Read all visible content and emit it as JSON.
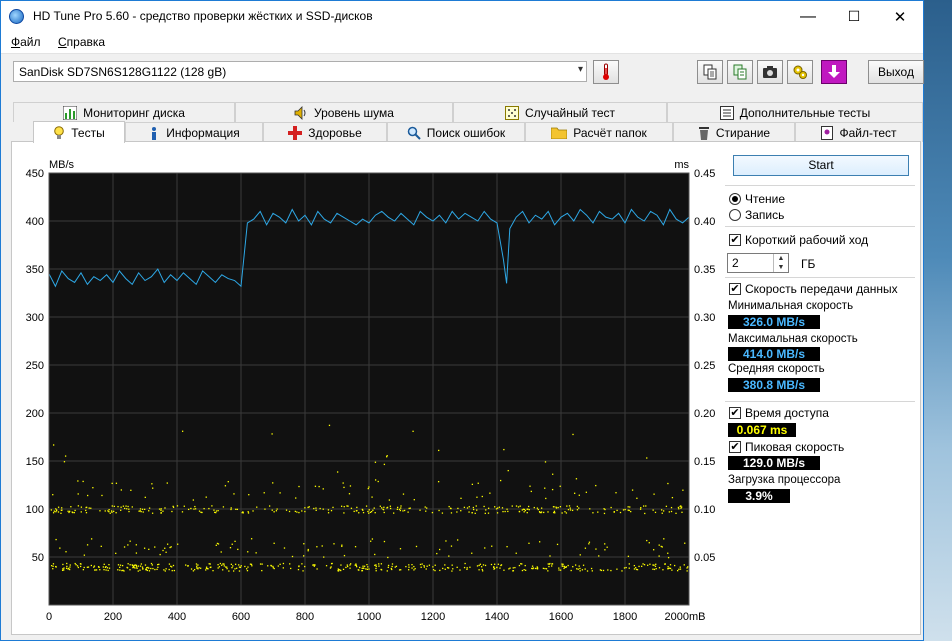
{
  "window": {
    "title": "HD Tune Pro 5.60 - средство проверки жёстких и SSD-дисков",
    "minimize_glyph": "—",
    "maximize_glyph": "☐",
    "close_glyph": "✕"
  },
  "menu": [
    "Файл",
    "Справка"
  ],
  "toolbar": {
    "drive": "SanDisk SD7SN6S128G1122 (128 gB)",
    "exit_label": "Выход",
    "icons": [
      "thermometer-icon",
      "copy-icon",
      "copy-all-icon",
      "camera-icon",
      "settings-icon",
      "download-icon"
    ]
  },
  "tabs_top": [
    {
      "label": "Мониторинг диска",
      "icon": "▮"
    },
    {
      "label": "Уровень шума",
      "icon": "🔊"
    },
    {
      "label": "Случайный тест",
      "icon": "▦"
    },
    {
      "label": "Дополнительные тесты",
      "icon": "▤"
    }
  ],
  "tabs_bottom": [
    {
      "label": "Тесты",
      "icon": "💡"
    },
    {
      "label": "Информация",
      "icon": "ℹ"
    },
    {
      "label": "Здоровье",
      "icon": "✚"
    },
    {
      "label": "Поиск ошибок",
      "icon": "🔍"
    },
    {
      "label": "Расчёт папок",
      "icon": "📁"
    },
    {
      "label": "Стирание",
      "icon": "🗑"
    },
    {
      "label": "Файл-тест",
      "icon": "📄"
    }
  ],
  "panel": {
    "start_label": "Start",
    "read_label": "Чтение",
    "write_label": "Запись",
    "short_stroke_label": "Короткий рабочий ход",
    "short_stroke_value": "2",
    "short_stroke_unit": "ГБ",
    "transfer_rate_label": "Скорость передачи данных",
    "min_label": "Минимальная скорость",
    "min_value": "326.0 MB/s",
    "max_label": "Максимальная скорость",
    "max_value": "414.0 MB/s",
    "avg_label": "Средняя скорость",
    "avg_value": "380.8 MB/s",
    "access_label": "Время доступа",
    "access_value": "0.067 ms",
    "burst_label": "Пиковая скорость",
    "burst_value": "129.0 MB/s",
    "cpu_label": "Загрузка процессора",
    "cpu_value": "3.9%"
  },
  "chart_data": {
    "type": "line",
    "left_unit": "MB/s",
    "right_unit": "ms",
    "x_unit": "mB",
    "xlim": [
      0,
      2000
    ],
    "ylim_left": [
      0,
      450
    ],
    "ylim_right": [
      0,
      0.45
    ],
    "x_ticks": [
      0,
      200,
      400,
      600,
      800,
      1000,
      1200,
      1400,
      1600,
      1800,
      2000
    ],
    "y_ticks_left": [
      50,
      100,
      150,
      200,
      250,
      300,
      350,
      400,
      450
    ],
    "y_ticks_right": [
      "0.05",
      "0.10",
      "0.15",
      "0.20",
      "0.25",
      "0.30",
      "0.35",
      "0.40",
      "0.45"
    ],
    "series": [
      {
        "kind": "transfer-rate",
        "color": "#2ea8e6",
        "x": [
          0,
          20,
          40,
          60,
          80,
          100,
          120,
          140,
          160,
          180,
          200,
          220,
          240,
          260,
          280,
          300,
          320,
          340,
          360,
          380,
          400,
          420,
          440,
          460,
          480,
          500,
          520,
          540,
          560,
          580,
          600,
          620,
          640,
          660,
          680,
          700,
          720,
          740,
          760,
          780,
          800,
          820,
          840,
          860,
          880,
          900,
          920,
          940,
          960,
          980,
          1000,
          1020,
          1040,
          1060,
          1080,
          1100,
          1120,
          1140,
          1160,
          1180,
          1200,
          1220,
          1240,
          1260,
          1280,
          1300,
          1320,
          1340,
          1360,
          1380,
          1400,
          1420,
          1430,
          1440,
          1460,
          1480,
          1500,
          1520,
          1540,
          1560,
          1580,
          1600,
          1620,
          1640,
          1660,
          1680,
          1700,
          1720,
          1740,
          1760,
          1780,
          1800,
          1820,
          1840,
          1860,
          1880,
          1900,
          1920,
          1940,
          1960,
          1980,
          2000
        ],
        "y": [
          345,
          332,
          348,
          340,
          336,
          346,
          334,
          342,
          338,
          344,
          336,
          348,
          340,
          334,
          346,
          338,
          342,
          350,
          336,
          344,
          338,
          346,
          340,
          334,
          348,
          342,
          336,
          344,
          340,
          338,
          332,
          398,
          402,
          410,
          396,
          408,
          404,
          398,
          412,
          400,
          406,
          396,
          410,
          402,
          398,
          408,
          404,
          400,
          396,
          402,
          398,
          406,
          410,
          404,
          400,
          408,
          402,
          396,
          410,
          404,
          400,
          406,
          398,
          410,
          402,
          408,
          404,
          400,
          410,
          402,
          398,
          360,
          335,
          392,
          404,
          410,
          398,
          406,
          402,
          410,
          396,
          404,
          408,
          400,
          412,
          406,
          398,
          410,
          404,
          402,
          408,
          398,
          412,
          404,
          400,
          410,
          406,
          396,
          412,
          402,
          398,
          404
        ]
      },
      {
        "kind": "access-time",
        "color": "#ffff00",
        "note_levels_ms": [
          0.04,
          0.06,
          0.1,
          0.12
        ]
      }
    ]
  }
}
